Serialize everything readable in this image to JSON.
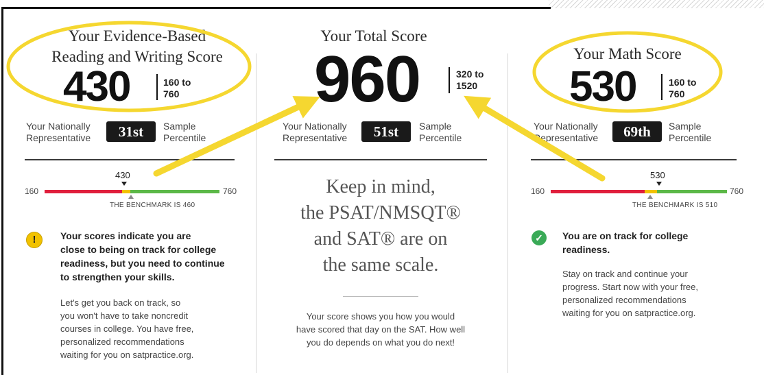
{
  "ebrw": {
    "heading_line1": "Your Evidence-Based",
    "heading_line2": "Reading and Writing Score",
    "score": "430",
    "range_line1": "160 to",
    "range_line2": "760",
    "percentile_left_1": "Your Nationally",
    "percentile_left_2": "Representative",
    "percentile": "31st",
    "percentile_right_1": "Sample",
    "percentile_right_2": "Percentile",
    "bar_min": "160",
    "bar_max": "760",
    "marker_value": "430",
    "benchmark": "THE BENCHMARK IS 460",
    "status_icon": "exclamation-icon",
    "status_color": "#f2c200",
    "message_bold": [
      "Your scores indicate you are",
      "close to being on track for college",
      "readiness, but you need to continue",
      "to strengthen your skills."
    ],
    "message": [
      "Let's get you back on track, so",
      "you won't have to take noncredit",
      "courses in college. You have free,",
      "personalized recommendations",
      "waiting for you on satpractice.org."
    ]
  },
  "total": {
    "heading": "Your Total Score",
    "score": "960",
    "range_line1": "320 to",
    "range_line2": "1520",
    "percentile_left_1": "Your Nationally",
    "percentile_left_2": "Representative",
    "percentile": "51st",
    "percentile_right_1": "Sample",
    "percentile_right_2": "Percentile",
    "keep_in_mind": [
      "Keep in mind,",
      "the PSAT/NMSQT®",
      "and SAT® are on",
      "the same scale."
    ],
    "message": [
      "Your score shows you how you would",
      "have scored that day on the SAT. How well",
      "you do depends on what you do next!"
    ]
  },
  "math": {
    "heading": "Your Math Score",
    "score": "530",
    "range_line1": "160 to",
    "range_line2": "760",
    "percentile_left_1": "Your Nationally",
    "percentile_left_2": "Representative",
    "percentile": "69th",
    "percentile_right_1": "Sample",
    "percentile_right_2": "Percentile",
    "bar_min": "160",
    "bar_max": "760",
    "marker_value": "530",
    "benchmark": "THE BENCHMARK IS 510",
    "status_icon": "checkmark-icon",
    "status_color": "#3aaa57",
    "message_bold": [
      "You are on track for college",
      "readiness."
    ],
    "message": [
      "Stay on track and continue your",
      "progress. Start now with your free,",
      "personalized recommendations",
      "waiting for you on satpractice.org."
    ]
  },
  "colors": {
    "below_benchmark": "#e01f3d",
    "above_benchmark": "#5cb848",
    "marker": "#f2c200",
    "annotation": "#f5d730"
  }
}
